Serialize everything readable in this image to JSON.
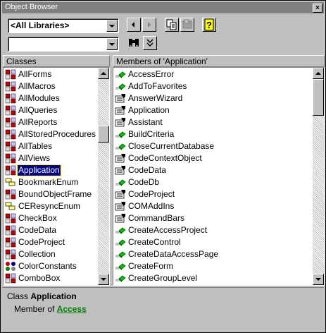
{
  "window": {
    "title": "Object Browser",
    "close_glyph": "×"
  },
  "toolbar": {
    "library_combo_value": "<All Libraries>",
    "search_combo_value": "",
    "icons": [
      "go-back-icon",
      "go-forward-icon",
      "copy-icon",
      "view-definition-icon",
      "help-icon",
      "search-binoculars-icon",
      "show-hide-results-icon"
    ]
  },
  "classes_pane": {
    "header": "Classes",
    "items": [
      {
        "label": "AllForms",
        "icon": "class-icon"
      },
      {
        "label": "AllMacros",
        "icon": "class-icon"
      },
      {
        "label": "AllModules",
        "icon": "class-icon"
      },
      {
        "label": "AllQueries",
        "icon": "class-icon"
      },
      {
        "label": "AllReports",
        "icon": "class-icon"
      },
      {
        "label": "AllStoredProcedures",
        "icon": "class-icon"
      },
      {
        "label": "AllTables",
        "icon": "class-icon"
      },
      {
        "label": "AllViews",
        "icon": "class-icon"
      },
      {
        "label": "Application",
        "icon": "class-icon",
        "selected": true
      },
      {
        "label": "BookmarkEnum",
        "icon": "enum-icon"
      },
      {
        "label": "BoundObjectFrame",
        "icon": "class-icon"
      },
      {
        "label": "CEResyncEnum",
        "icon": "enum-icon"
      },
      {
        "label": "CheckBox",
        "icon": "class-icon"
      },
      {
        "label": "CodeData",
        "icon": "class-icon"
      },
      {
        "label": "CodeProject",
        "icon": "class-icon"
      },
      {
        "label": "Collection",
        "icon": "class-icon"
      },
      {
        "label": "ColorConstants",
        "icon": "module-icon"
      },
      {
        "label": "ComboBox",
        "icon": "class-icon"
      }
    ]
  },
  "members_pane": {
    "header": "Members of 'Application'",
    "items": [
      {
        "label": "AccessError",
        "icon": "method-icon"
      },
      {
        "label": "AddToFavorites",
        "icon": "method-icon"
      },
      {
        "label": "AnswerWizard",
        "icon": "property-icon"
      },
      {
        "label": "Application",
        "icon": "property-icon"
      },
      {
        "label": "Assistant",
        "icon": "property-icon"
      },
      {
        "label": "BuildCriteria",
        "icon": "method-icon"
      },
      {
        "label": "CloseCurrentDatabase",
        "icon": "method-icon"
      },
      {
        "label": "CodeContextObject",
        "icon": "property-icon"
      },
      {
        "label": "CodeData",
        "icon": "property-icon"
      },
      {
        "label": "CodeDb",
        "icon": "method-icon"
      },
      {
        "label": "CodeProject",
        "icon": "property-icon"
      },
      {
        "label": "COMAddIns",
        "icon": "property-icon"
      },
      {
        "label": "CommandBars",
        "icon": "property-icon"
      },
      {
        "label": "CreateAccessProject",
        "icon": "method-icon"
      },
      {
        "label": "CreateControl",
        "icon": "method-icon"
      },
      {
        "label": "CreateDataAccessPage",
        "icon": "method-icon"
      },
      {
        "label": "CreateForm",
        "icon": "method-icon"
      },
      {
        "label": "CreateGroupLevel",
        "icon": "method-icon"
      }
    ]
  },
  "details": {
    "kind": "Class",
    "name": "Application",
    "member_of_prefix": "Member of",
    "library": "Access"
  },
  "colors": {
    "selection": "#000080",
    "link": "#008000",
    "chrome": "#c0c0c0"
  }
}
